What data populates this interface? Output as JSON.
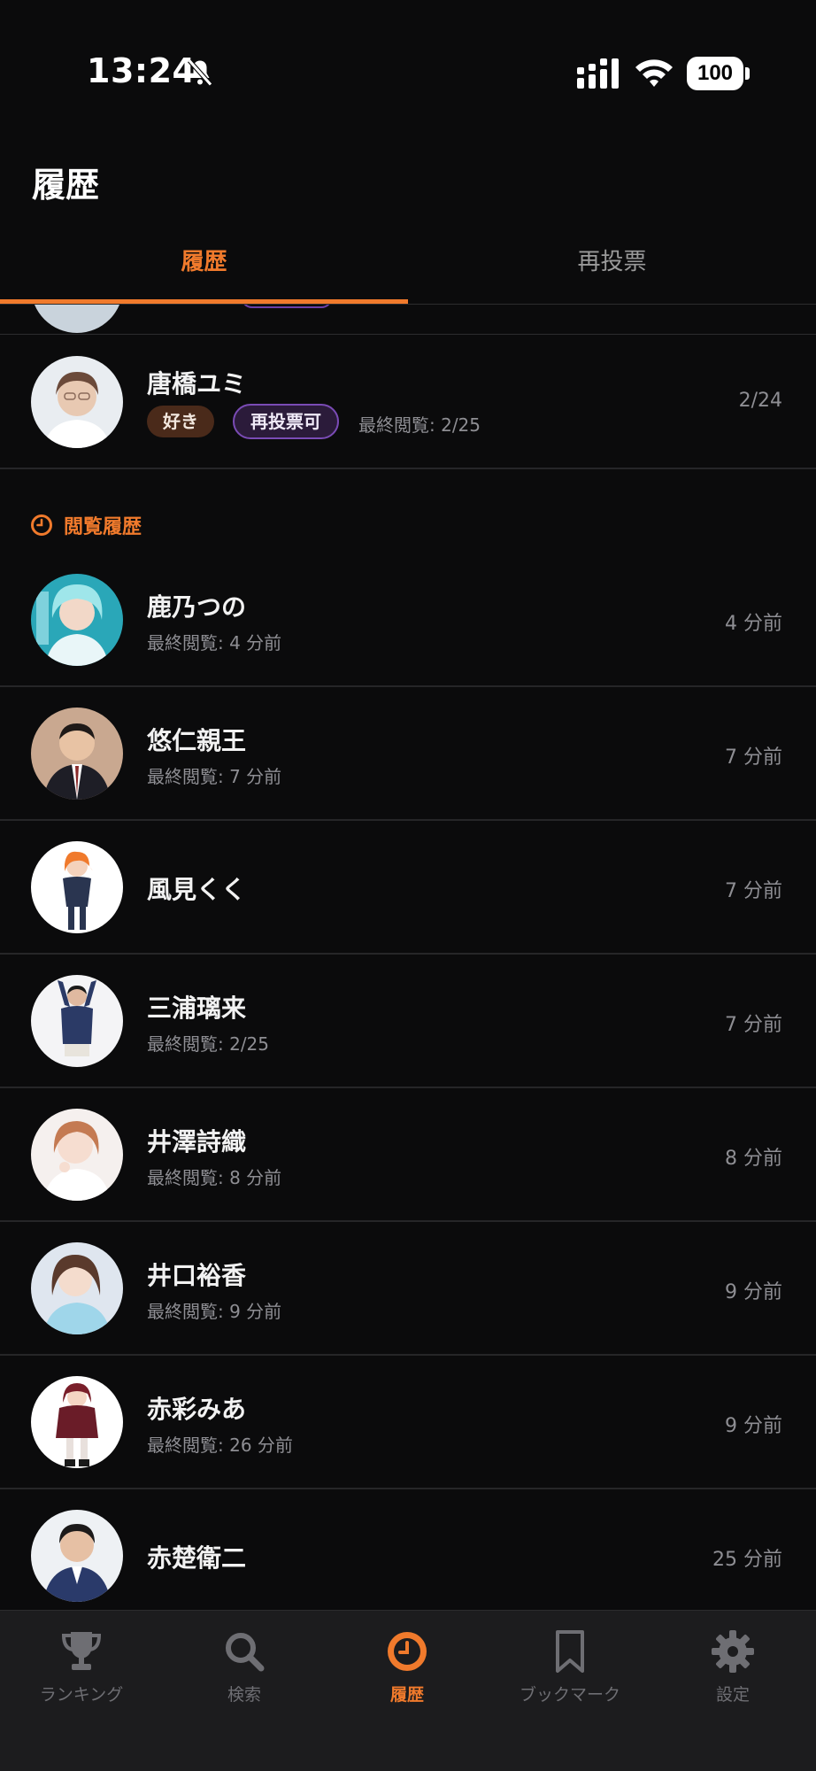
{
  "status_bar": {
    "time": "13:24",
    "battery": "100"
  },
  "header": {
    "title": "履歴"
  },
  "tabs": [
    {
      "label": "履歴",
      "active": true
    },
    {
      "label": "再投票",
      "active": false
    }
  ],
  "vote_entry": {
    "name": "唐橋ユミ",
    "tag_like": "好き",
    "tag_revote": "再投票可",
    "last_view": "最終閲覧: 2/25",
    "date": "2/24"
  },
  "history_section": {
    "title": "閲覧履歴",
    "icon": "clock-icon"
  },
  "history": [
    {
      "name": "鹿乃つの",
      "sub": "最終閲覧: 4 分前",
      "time": "4 分前"
    },
    {
      "name": "悠仁親王",
      "sub": "最終閲覧: 7 分前",
      "time": "7 分前"
    },
    {
      "name": "風見くく",
      "sub": "",
      "time": "7 分前"
    },
    {
      "name": "三浦璃来",
      "sub": "最終閲覧: 2/25",
      "time": "7 分前"
    },
    {
      "name": "井澤詩織",
      "sub": "最終閲覧: 8 分前",
      "time": "8 分前"
    },
    {
      "name": "井口裕香",
      "sub": "最終閲覧: 9 分前",
      "time": "9 分前"
    },
    {
      "name": "赤彩みあ",
      "sub": "最終閲覧: 26 分前",
      "time": "9 分前"
    },
    {
      "name": "赤楚衛二",
      "sub": "",
      "time": "25 分前"
    }
  ],
  "bottom_nav": [
    {
      "label": "ランキング",
      "icon": "trophy-icon"
    },
    {
      "label": "検索",
      "icon": "search-icon"
    },
    {
      "label": "履歴",
      "icon": "clock-icon",
      "active": true
    },
    {
      "label": "ブックマーク",
      "icon": "bookmark-icon"
    },
    {
      "label": "設定",
      "icon": "gear-icon"
    }
  ],
  "colors": {
    "accent": "#f07a2c",
    "background": "#0b0b0c",
    "revote_border": "#7a4bb5"
  }
}
